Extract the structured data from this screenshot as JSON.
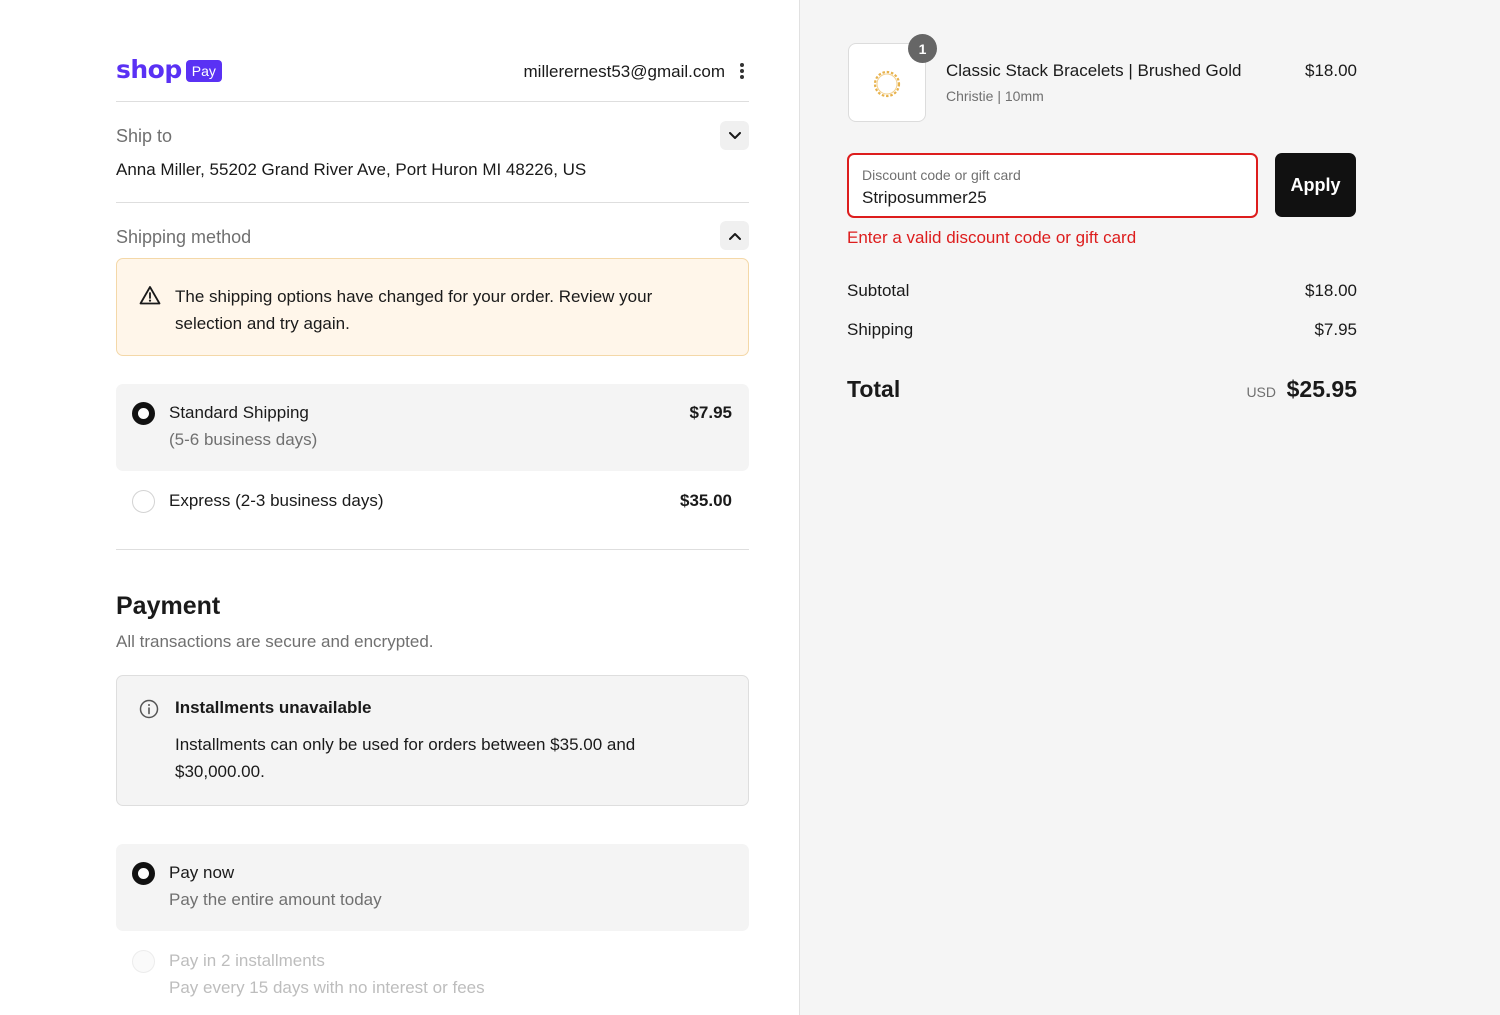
{
  "header": {
    "logo_word": "shop",
    "logo_badge": "Pay",
    "email": "millerernest53@gmail.com"
  },
  "ship_to": {
    "label": "Ship to",
    "address": "Anna Miller, 55202 Grand River Ave, Port Huron MI 48226, US"
  },
  "shipping_method": {
    "label": "Shipping method",
    "warning": "The shipping options have changed for your order. Review your selection and try again.",
    "options": [
      {
        "title": "Standard Shipping",
        "subtitle": "(5-6 business days)",
        "price": "$7.95",
        "selected": true
      },
      {
        "title": "Express (2-3 business days)",
        "subtitle": "",
        "price": "$35.00",
        "selected": false
      }
    ]
  },
  "payment": {
    "title": "Payment",
    "subtitle": "All transactions are secure and encrypted.",
    "notice_title": "Installments unavailable",
    "notice_text": "Installments can only be used for orders between $35.00 and $30,000.00.",
    "options": [
      {
        "title": "Pay now",
        "subtitle": "Pay the entire amount today",
        "selected": true,
        "disabled": false
      },
      {
        "title": "Pay in 2 installments",
        "subtitle": "Pay every 15 days with no interest or fees",
        "selected": false,
        "disabled": true
      }
    ]
  },
  "order": {
    "quantity": "1",
    "product_name": "Classic Stack Bracelets | Brushed Gold",
    "product_variant": "Christie | 10mm",
    "product_price": "$18.00"
  },
  "discount": {
    "placeholder": "Discount code or gift card",
    "value": "Striposummer25",
    "apply_label": "Apply",
    "error": "Enter a valid discount code or gift card"
  },
  "summary": {
    "subtotal_label": "Subtotal",
    "subtotal_value": "$18.00",
    "shipping_label": "Shipping",
    "shipping_value": "$7.95",
    "total_label": "Total",
    "currency": "USD",
    "total_value": "$25.95"
  },
  "colors": {
    "brand": "#5a31f4",
    "error": "#dd1d1d",
    "warning_bg": "#fff6ea",
    "warning_border": "#f4d8a8",
    "button_bg": "#111111"
  }
}
